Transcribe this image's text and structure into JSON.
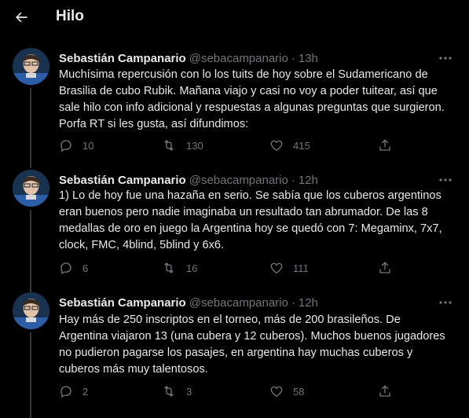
{
  "header": {
    "title": "Hilo",
    "back_icon": "arrow-left-icon"
  },
  "tweets": [
    {
      "author": "Sebastián Campanario",
      "handle": "@sebacampanario",
      "dot": "·",
      "time": "13h",
      "text": "Muchísima repercusión con lo los tuits de hoy sobre el Sudamericano de\nBrasilia de cubo Rubik. Mañana viajo y casi no voy a poder tuitear, así que\nsale hilo con info adicional y respuestas a algunas preguntas que surgieron.\nPorfa RT si les gusta, así difundimos:",
      "replies": "10",
      "retweets": "130",
      "likes": "415"
    },
    {
      "author": "Sebastián Campanario",
      "handle": "@sebacampanario",
      "dot": "·",
      "time": "12h",
      "text": "1) Lo de hoy fue una hazaña en serio. Se sabía que los cuberos argentinos\neran buenos pero nadie imaginaba un resultado tan abrumador. De las 8\nmedallas de oro en juego la Argentina hoy se quedó con 7: Megaminx, 7x7,\nclock, FMC, 4blind, 5blind y 6x6.",
      "replies": "6",
      "retweets": "16",
      "likes": "111"
    },
    {
      "author": "Sebastián Campanario",
      "handle": "@sebacampanario",
      "dot": "·",
      "time": "12h",
      "text": "Hay más de 250 inscriptos en el torneo, más de 200 brasileños. De\nArgentina viajaron 13 (una cubera y 12 cuberos). Muchos buenos jugadores\nno pudieron pagarse los pasajes, en argentina hay muchas cuberos y\ncuberos más muy talentosos.",
      "replies": "2",
      "retweets": "3",
      "likes": "58"
    }
  ],
  "colors": {
    "background": "#000000",
    "text": "#e7e9ea",
    "muted": "#71767b",
    "line": "#333639"
  }
}
